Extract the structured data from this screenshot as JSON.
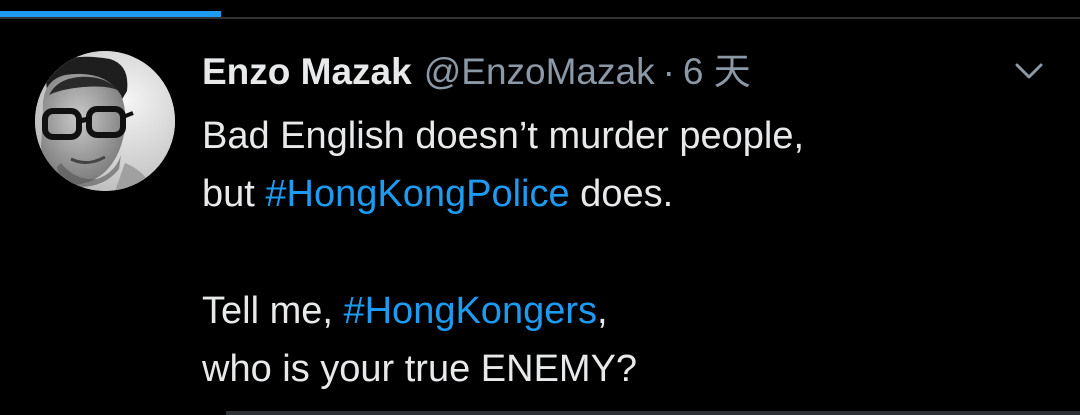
{
  "progress": {
    "fraction": 0.205,
    "color": "#1d9bf0"
  },
  "tweet": {
    "author": {
      "name": "Enzo Mazak",
      "handle": "@EnzoMazak",
      "avatar": "avatar-photo"
    },
    "separator": "·",
    "time": "6 天",
    "menu_icon": "chevron-down-icon",
    "lines": [
      {
        "text_before": "Bad English doesn’t murder people,"
      },
      {
        "text_before": "but ",
        "hashtag": "#HongKongPolice",
        "text_after": " does."
      },
      {
        "text_before": "Tell me, ",
        "hashtag": "#HongKongers",
        "text_after": ","
      },
      {
        "text_before": "who is your true ENEMY?"
      }
    ]
  },
  "colors": {
    "background": "#000000",
    "text": "#e7e9ea",
    "secondary_text": "#8b98a5",
    "link": "#1d9bf0",
    "divider": "#2f3336"
  }
}
